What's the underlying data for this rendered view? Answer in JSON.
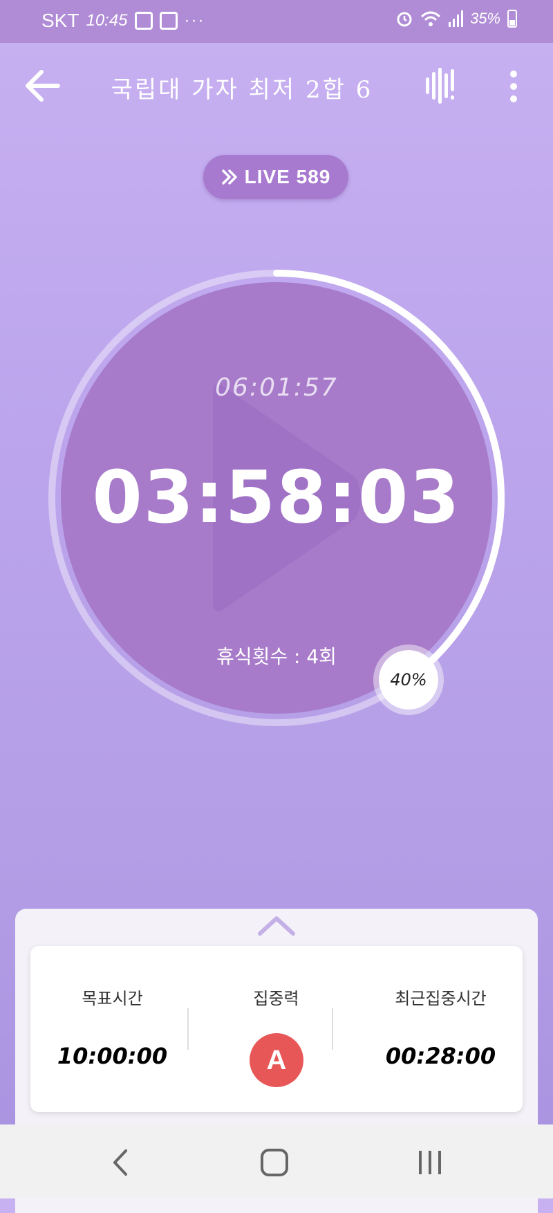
{
  "status_bar": {
    "carrier": "SKT",
    "time": "10:45",
    "more": "···",
    "battery": "35%"
  },
  "header": {
    "title": "국립대 가자 최저 2합 6"
  },
  "live": {
    "label": "LIVE 589"
  },
  "timer": {
    "elapsed": "06:01:57",
    "current": "03:58:03",
    "break_label": "휴식횟수 : 4회",
    "progress_label": "40%",
    "progress": 0.4
  },
  "stats": {
    "target_label": "목표시간",
    "target_value": "10:00:00",
    "focus_label": "집중력",
    "focus_grade": "A",
    "recent_label": "최근집중시간",
    "recent_value": "00:28:00"
  },
  "colors": {
    "accent": "#a77ad0",
    "circle": "#a77bc9",
    "grade": "#e85757"
  }
}
